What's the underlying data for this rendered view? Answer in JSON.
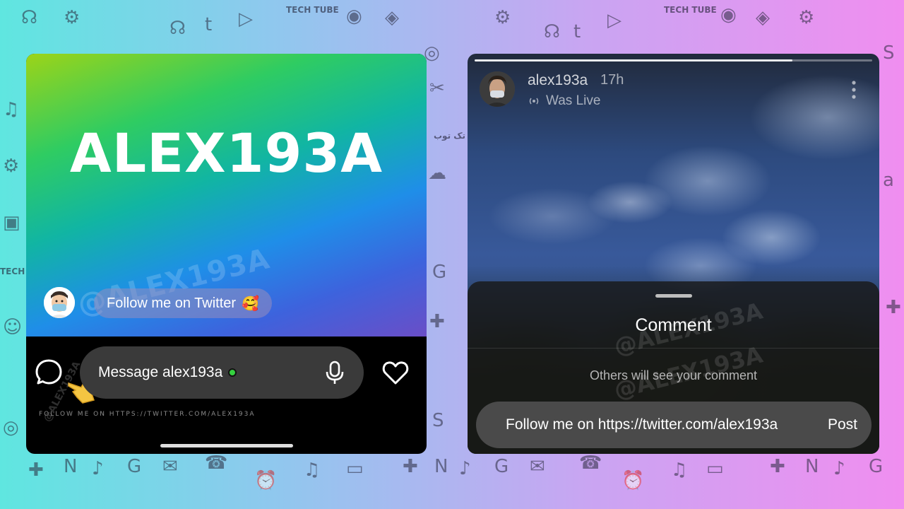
{
  "left_story": {
    "title": "ALEX193A",
    "caption": "Follow me on Twitter",
    "caption_emoji": "🥰",
    "watermark": "@ALEX193A",
    "message_placeholder": "Message alex193a",
    "footer_text": "FOLLOW ME ON HTTPS://TWITTER.COM/ALEX193A",
    "icons": {
      "comment": "comment-bubble-icon",
      "pointer": "pointing-hand-icon",
      "mic": "microphone-icon",
      "heart": "heart-icon"
    }
  },
  "right_story": {
    "username": "alex193a",
    "time": "17h",
    "status": "Was Live",
    "progress": 0.8,
    "sheet": {
      "title": "Comment",
      "note": "Others will see your comment",
      "watermark": "@ALEX193A",
      "input_value": "Follow me on https://twitter.com/alex193a",
      "post_label": "Post"
    }
  },
  "background": {
    "tags": [
      "TECH TUBE",
      "تک توب"
    ]
  },
  "colors": {
    "online_dot": "#35d13f",
    "sheet_bg": "#191919"
  }
}
